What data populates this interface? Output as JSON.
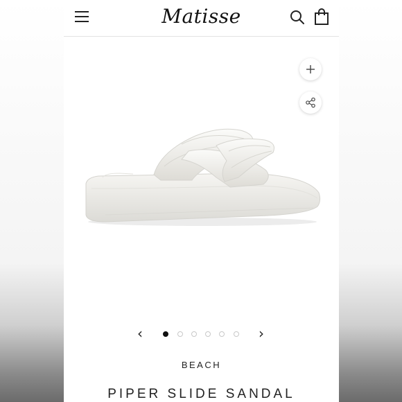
{
  "brand": {
    "logo_text": "Matisse"
  },
  "header": {
    "menu_icon": "hamburger-menu-icon",
    "search_icon": "search-icon",
    "cart_icon": "shopping-bag-icon"
  },
  "image_actions": {
    "zoom_icon": "plus-icon",
    "share_icon": "share-icon"
  },
  "product": {
    "image_alt": "white quilted crisscross platform slide sandal",
    "collection": "BEACH",
    "title": "PIPER SLIDE SANDAL"
  },
  "carousel": {
    "prev_icon": "chevron-left-icon",
    "next_icon": "chevron-right-icon",
    "prev_glyph": "‹",
    "next_glyph": "›",
    "slide_count": 6,
    "active_index": 0
  },
  "colors": {
    "accent": "#111111",
    "dot_inactive": "#c8c8c8",
    "divider": "#e3e3e3",
    "sandal": "#f2f1ee"
  }
}
